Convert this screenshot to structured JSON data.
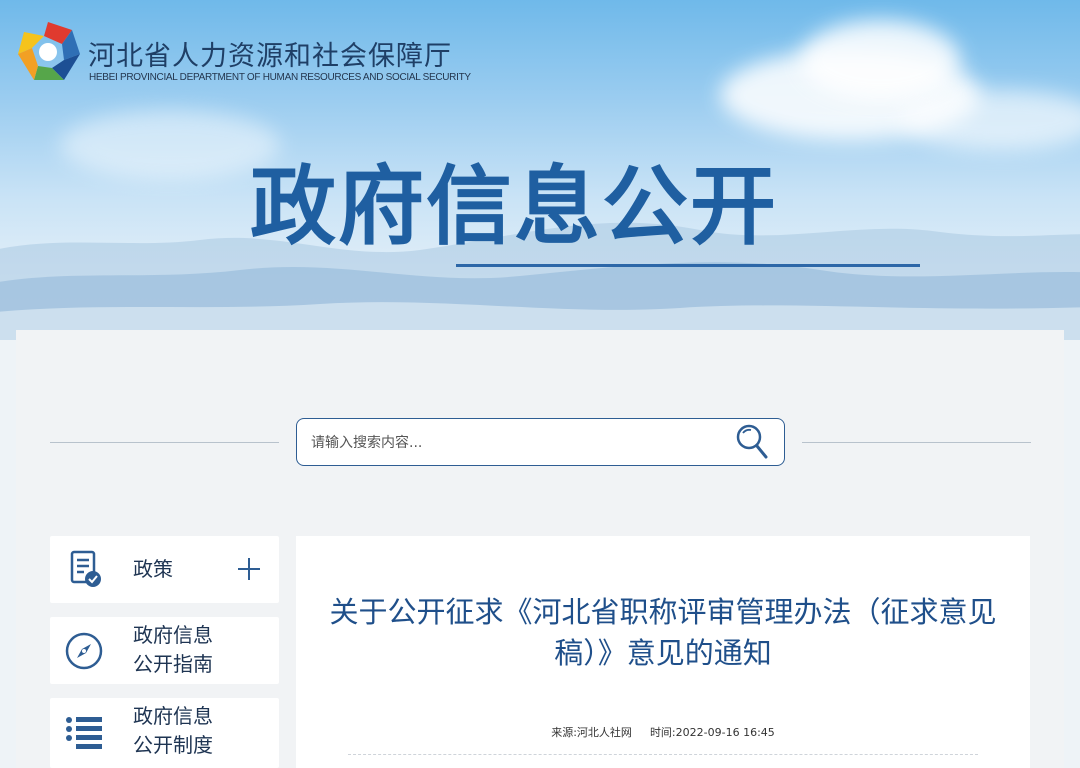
{
  "header": {
    "org_name_cn": "河北省人力资源和社会保障厅",
    "org_name_en": "HEBEI PROVINCIAL DEPARTMENT OF HUMAN RESOURCES AND SOCIAL SECURITY",
    "banner_title": "政府信息公开"
  },
  "search": {
    "placeholder": "请输入搜索内容..."
  },
  "sidebar": {
    "items": [
      {
        "label": "政策",
        "icon": "document-check-icon",
        "expand_icon": "plus-icon"
      },
      {
        "label": "政府信息\n公开指南",
        "icon": "compass-icon"
      },
      {
        "label": "政府信息\n公开制度",
        "icon": "list-icon"
      }
    ]
  },
  "article": {
    "title": "关于公开征求《河北省职称评审管理办法（征求意见稿）》意见的通知",
    "source": "来源:河北人社网",
    "time": "时间:2022-09-16 16:45"
  },
  "colors": {
    "brand_blue": "#1f5fa1",
    "title_blue": "#1f4f8a",
    "text_dark": "#1e3452"
  }
}
